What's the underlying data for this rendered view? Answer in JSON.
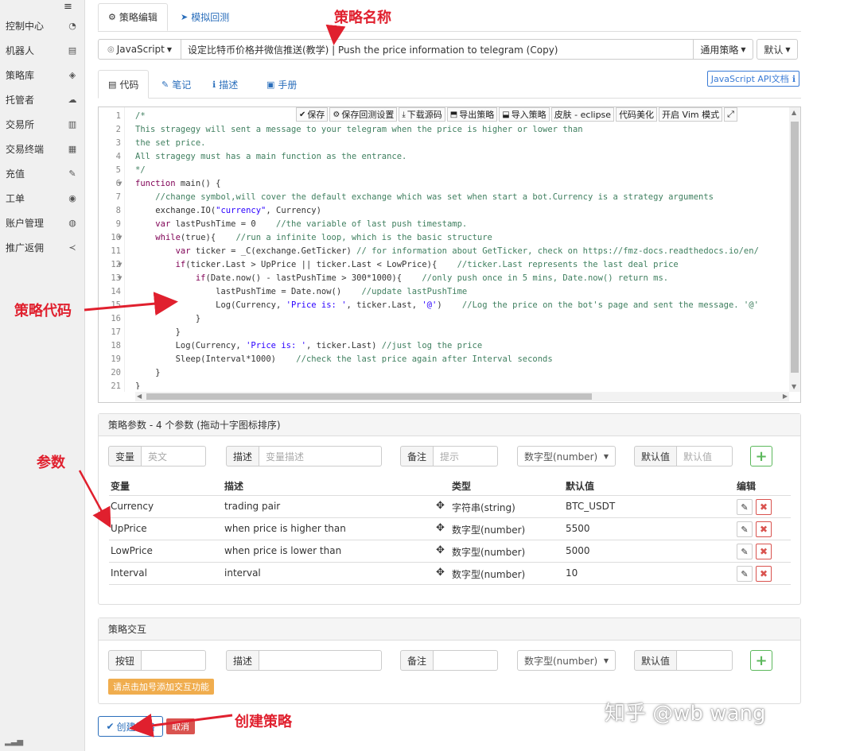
{
  "sidebar": {
    "menu_icon": "≡",
    "items": [
      {
        "label": "控制中心",
        "icon": "dashboard-icon",
        "glyph": "◔"
      },
      {
        "label": "机器人",
        "icon": "server-icon",
        "glyph": "▤"
      },
      {
        "label": "策略库",
        "icon": "cube-icon",
        "glyph": "◈"
      },
      {
        "label": "托管者",
        "icon": "cloud-icon",
        "glyph": "☁"
      },
      {
        "label": "交易所",
        "icon": "bank-icon",
        "glyph": "▥"
      },
      {
        "label": "交易终端",
        "icon": "calculator-icon",
        "glyph": "▦"
      },
      {
        "label": "充值",
        "icon": "wrench-icon",
        "glyph": "✎"
      },
      {
        "label": "工单",
        "icon": "comment-icon",
        "glyph": "◉"
      },
      {
        "label": "账户管理",
        "icon": "user-circle-icon",
        "glyph": "◍"
      },
      {
        "label": "推广返佣",
        "icon": "share-icon",
        "glyph": "≺"
      }
    ]
  },
  "top_tabs": {
    "edit": {
      "label": "策略编辑",
      "glyph": "⚙"
    },
    "backtest": {
      "label": "模拟回测",
      "glyph": "➤"
    }
  },
  "toolbar_row": {
    "language": "JavaScript",
    "strategy_name": "设定比特币价格并微信推送(教学) | Push the price information to telegram (Copy)",
    "general_strategy": "通用策略",
    "default": "默认"
  },
  "sub_tabs": {
    "code": "代码",
    "notes": "笔记",
    "description": "描述",
    "manual": "手册",
    "api_doc": "JavaScript API文档"
  },
  "editor_toolbar": {
    "save": "保存",
    "save_backtest": "保存回测设置",
    "download_source": "下载源码",
    "export_strategy": "导出策略",
    "import_strategy": "导入策略",
    "skin": "皮肤 - eclipse",
    "beautify": "代码美化",
    "vim": "开启 Vim 模式"
  },
  "code_lines": [
    [
      [
        "cm",
        "/*"
      ]
    ],
    [
      [
        "cm",
        "This stragegy will sent a message to your telegram when the price is higher or lower than"
      ]
    ],
    [
      [
        "cm",
        "the set price."
      ]
    ],
    [
      [
        "cm",
        "All stragegy must has a main function as the entrance."
      ]
    ],
    [
      [
        "cm",
        "*/"
      ]
    ],
    [
      [
        "kw",
        "function"
      ],
      [
        "pl",
        " main() {"
      ]
    ],
    [
      [
        "pl",
        "    "
      ],
      [
        "cm",
        "//change symbol,will cover the default exchange which was set when start a bot.Currency is a strategy arguments"
      ]
    ],
    [
      [
        "pl",
        "    exchange.IO("
      ],
      [
        "str",
        "\"currency\""
      ],
      [
        "pl",
        ", Currency)"
      ]
    ],
    [
      [
        "pl",
        "    "
      ],
      [
        "kw",
        "var"
      ],
      [
        "pl",
        " lastPushTime = 0    "
      ],
      [
        "cm",
        "//the variable of last push timestamp."
      ]
    ],
    [
      [
        "pl",
        "    "
      ],
      [
        "kw",
        "while"
      ],
      [
        "pl",
        "(true){    "
      ],
      [
        "cm",
        "//run a infinite loop, which is the basic structure"
      ]
    ],
    [
      [
        "pl",
        "        "
      ],
      [
        "kw",
        "var"
      ],
      [
        "pl",
        " ticker = _C(exchange.GetTicker) "
      ],
      [
        "cm",
        "// for information about GetTicker, check on https://fmz-docs.readthedocs.io/en/"
      ]
    ],
    [
      [
        "pl",
        "        "
      ],
      [
        "kw",
        "if"
      ],
      [
        "pl",
        "(ticker.Last > UpPrice || ticker.Last < LowPrice){    "
      ],
      [
        "cm",
        "//ticker.Last represents the last deal price"
      ]
    ],
    [
      [
        "pl",
        "            "
      ],
      [
        "kw",
        "if"
      ],
      [
        "pl",
        "(Date.now() - lastPushTime > 300*1000){    "
      ],
      [
        "cm",
        "//only push once in 5 mins, Date.now() return ms."
      ]
    ],
    [
      [
        "pl",
        "                lastPushTime = Date.now()    "
      ],
      [
        "cm",
        "//update lastPushTime"
      ]
    ],
    [
      [
        "pl",
        "                Log(Currency, "
      ],
      [
        "str",
        "'Price is: '"
      ],
      [
        "pl",
        ", ticker.Last, "
      ],
      [
        "str",
        "'@'"
      ],
      [
        "pl",
        ")    "
      ],
      [
        "cm",
        "//Log the price on the bot's page and sent the message. '@'"
      ]
    ],
    [
      [
        "pl",
        "            }"
      ]
    ],
    [
      [
        "pl",
        "        }"
      ]
    ],
    [
      [
        "pl",
        "        Log(Currency, "
      ],
      [
        "str",
        "'Price is: '"
      ],
      [
        "pl",
        ", ticker.Last) "
      ],
      [
        "cm",
        "//just log the price"
      ]
    ],
    [
      [
        "pl",
        "        Sleep(Interval*1000)    "
      ],
      [
        "cm",
        "//check the last price again after Interval seconds"
      ]
    ],
    [
      [
        "pl",
        "    }"
      ]
    ],
    [
      [
        "pl",
        "}"
      ]
    ]
  ],
  "line_numbers": [
    "1",
    "2",
    "3",
    "4",
    "5",
    "6",
    "7",
    "8",
    "9",
    "10",
    "11",
    "12",
    "13",
    "14",
    "15",
    "16",
    "17",
    "18",
    "19",
    "20",
    "21"
  ],
  "params_panel": {
    "title": "策略参数 - 4 个参数 (拖动十字图标排序)",
    "var_label": "变量",
    "var_placeholder": "英文",
    "desc_label": "描述",
    "desc_placeholder": "变量描述",
    "note_label": "备注",
    "note_placeholder": "提示",
    "type_select": "数字型(number)",
    "default_label": "默认值",
    "default_placeholder": "默认值",
    "headers": {
      "var": "变量",
      "desc": "描述",
      "type": "类型",
      "default": "默认值",
      "edit": "编辑"
    },
    "rows": [
      {
        "var": "Currency",
        "desc": "trading pair",
        "type": "字符串(string)",
        "default": "BTC_USDT"
      },
      {
        "var": "UpPrice",
        "desc": "when price is higher than",
        "type": "数字型(number)",
        "default": "5500"
      },
      {
        "var": "LowPrice",
        "desc": "when price is lower than",
        "type": "数字型(number)",
        "default": "5000"
      },
      {
        "var": "Interval",
        "desc": "interval",
        "type": "数字型(number)",
        "default": "10"
      }
    ]
  },
  "interact_panel": {
    "title": "策略交互",
    "button_label": "按钮",
    "desc_label": "描述",
    "note_label": "备注",
    "type_select": "数字型(number)",
    "default_label": "默认值",
    "hint": "请点击加号添加交互功能"
  },
  "footer": {
    "create": "创建策略",
    "cancel": "取消"
  },
  "annotations": {
    "name": "策略名称",
    "code": "策略代码",
    "params": "参数",
    "create": "创建策略"
  },
  "watermark": "知乎 @wb wang",
  "colors": {
    "accent": "#2a6ebb",
    "annotation": "#e0202e",
    "success": "#5cb85c",
    "danger": "#d9534f",
    "warning": "#f0ad4e"
  }
}
